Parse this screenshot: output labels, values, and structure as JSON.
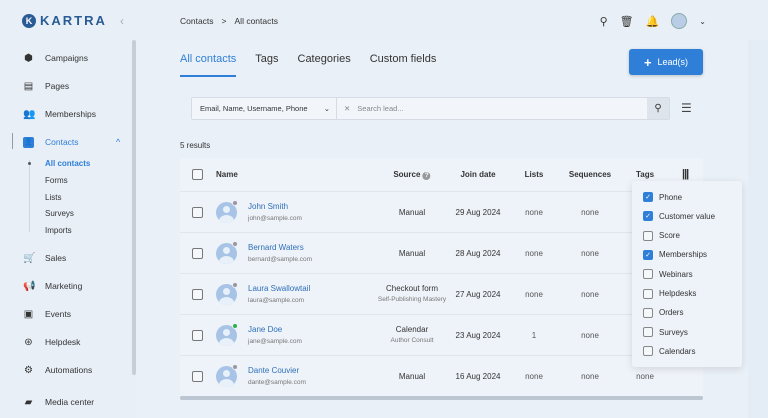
{
  "app": {
    "logo": "KARTRA",
    "collapse_icon": "chevron-left-icon"
  },
  "sidebar": {
    "items": [
      {
        "label": "Campaigns",
        "icon": "cube-icon",
        "glyph": "⬢"
      },
      {
        "label": "Pages",
        "icon": "page-icon",
        "glyph": "▤"
      },
      {
        "label": "Memberships",
        "icon": "people-icon",
        "glyph": "👥"
      },
      {
        "label": "Contacts",
        "icon": "contact-icon",
        "glyph": "👤",
        "active": true
      },
      {
        "label": "Sales",
        "icon": "cart-icon",
        "glyph": "🛒"
      },
      {
        "label": "Marketing",
        "icon": "megaphone-icon",
        "glyph": "📢"
      },
      {
        "label": "Events",
        "icon": "calendar-icon",
        "glyph": "▣"
      },
      {
        "label": "Helpdesk",
        "icon": "lifebuoy-icon",
        "glyph": "⊛"
      },
      {
        "label": "Automations",
        "icon": "gears-icon",
        "glyph": "⚙"
      },
      {
        "label": "Media center",
        "icon": "folder-icon",
        "glyph": "▰"
      }
    ],
    "contacts_sub": [
      "All contacts",
      "Forms",
      "Lists",
      "Surveys",
      "Imports"
    ]
  },
  "breadcrumb": {
    "items": [
      "Contacts",
      "All contacts"
    ],
    "separator": ">"
  },
  "tabs": [
    "All contacts",
    "Tags",
    "Categories",
    "Custom fields"
  ],
  "lead_button": "Lead(s)",
  "search": {
    "field_select": "Email, Name, Username, Phone",
    "placeholder": "Search lead..."
  },
  "results": "5 results",
  "table": {
    "headers": {
      "name": "Name",
      "source": "Source",
      "join": "Join date",
      "lists": "Lists",
      "sequences": "Sequences",
      "tags": "Tags"
    },
    "rows": [
      {
        "name": "John Smith",
        "email": "john@sample.com",
        "source": "Manual",
        "source_sub": "",
        "join": "29 Aug 2024",
        "lists": "none",
        "sequences": "none",
        "tags": "",
        "online": false
      },
      {
        "name": "Bernard Waters",
        "email": "bernard@sample.com",
        "source": "Manual",
        "source_sub": "",
        "join": "28 Aug 2024",
        "lists": "none",
        "sequences": "none",
        "tags": "",
        "online": false
      },
      {
        "name": "Laura Swallowtail",
        "email": "laura@sample.com",
        "source": "Checkout form",
        "source_sub": "Self-Publishing Mastery",
        "join": "27 Aug 2024",
        "lists": "none",
        "sequences": "none",
        "tags": "",
        "online": false
      },
      {
        "name": "Jane Doe",
        "email": "jane@sample.com",
        "source": "Calendar",
        "source_sub": "Author Consult",
        "join": "23 Aug 2024",
        "lists": "1",
        "sequences": "none",
        "tags": "",
        "online": true
      },
      {
        "name": "Dante Couvier",
        "email": "dante@sample.com",
        "source": "Manual",
        "source_sub": "",
        "join": "16 Aug 2024",
        "lists": "none",
        "sequences": "none",
        "tags": "none",
        "online": false
      }
    ]
  },
  "columns_menu": [
    {
      "label": "Phone",
      "checked": true
    },
    {
      "label": "Customer value",
      "checked": true
    },
    {
      "label": "Score",
      "checked": false
    },
    {
      "label": "Memberships",
      "checked": true
    },
    {
      "label": "Webinars",
      "checked": false
    },
    {
      "label": "Helpdesks",
      "checked": false
    },
    {
      "label": "Orders",
      "checked": false
    },
    {
      "label": "Surveys",
      "checked": false
    },
    {
      "label": "Calendars",
      "checked": false
    }
  ],
  "colors": {
    "accent": "#2f7fd8",
    "online": "#2fb344",
    "offline": "#999999"
  }
}
